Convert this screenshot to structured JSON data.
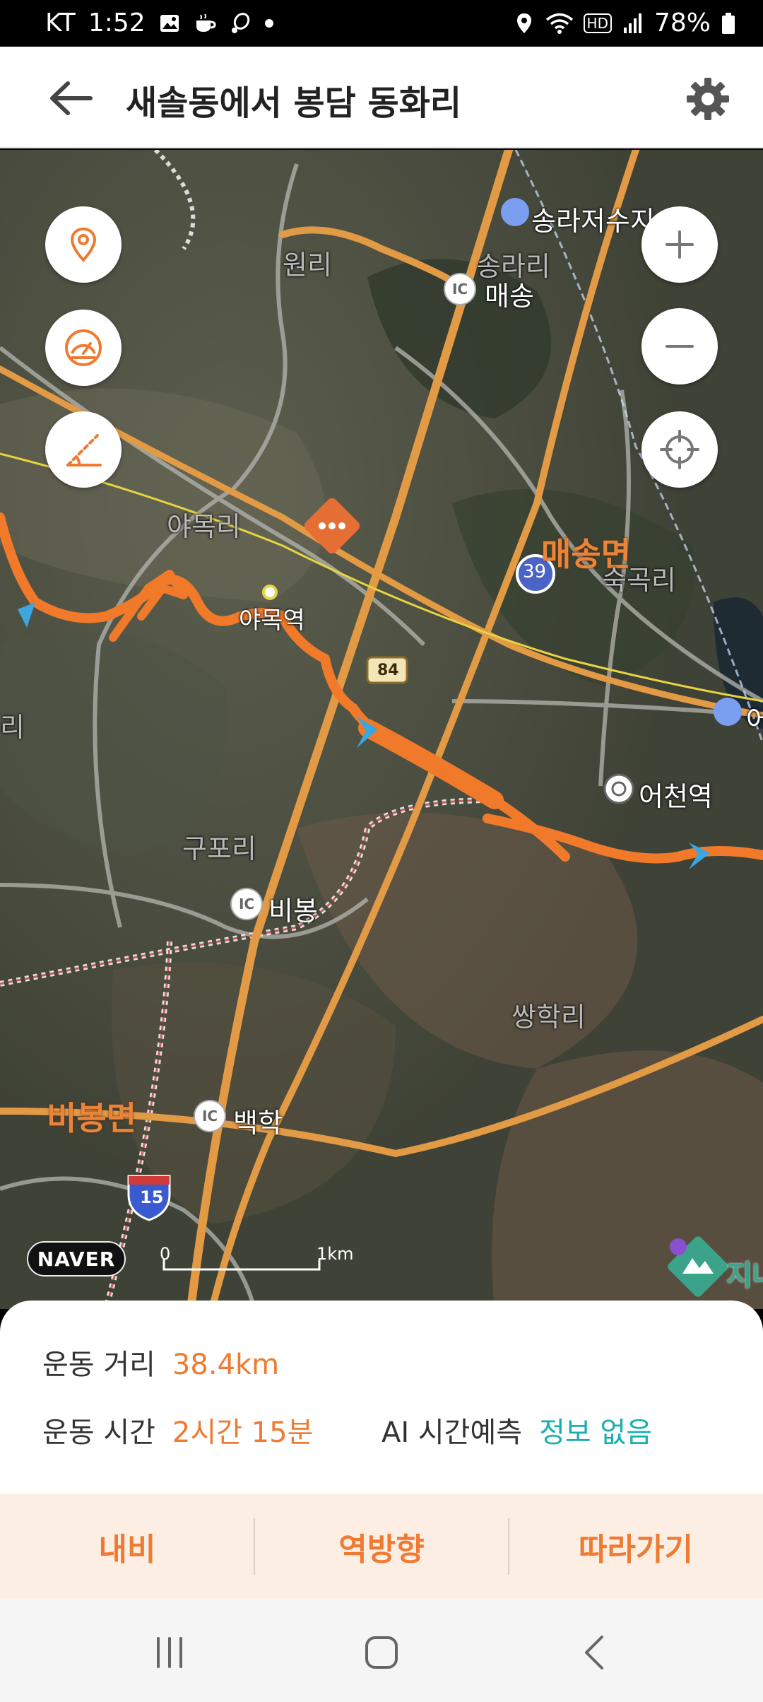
{
  "status_bar": {
    "carrier": "KT",
    "time": "1:52",
    "hd_label": "HD",
    "battery": "78%"
  },
  "header": {
    "title": "새솔동에서 봉담 동화리"
  },
  "map": {
    "places": {
      "songra_reservoir": "송라저수지",
      "wonri": "원리",
      "songrari": "송라리",
      "maesong": "매송",
      "yamokri": "야목리",
      "yamok_station": "야목역",
      "maesong_myeon": "매송면",
      "sukgokri": "숙곡리",
      "route_39": "39",
      "route_84": "84",
      "eocheon_station": "어천역",
      "eo_partial": "어",
      "ri_partial": "리",
      "gupori": "구포리",
      "bibong": "비봉",
      "ssanghakri": "쌍학리",
      "bibong_myeon": "비봉면",
      "baekhak": "백학",
      "route_15": "15",
      "ji_partial": "지나",
      "ic_label": "IC"
    },
    "naver_logo": "NAVER",
    "scale_start": "0",
    "scale_end": "1km",
    "route_color": "#f07a2a"
  },
  "stats": {
    "distance_label": "운동 거리",
    "distance_value": "38.4km",
    "time_label": "운동 시간",
    "time_value": "2시간 15분",
    "ai_label": "AI 시간예측",
    "ai_value": "정보 없음"
  },
  "actions": {
    "navi": "내비",
    "reverse": "역방향",
    "follow": "따라가기"
  },
  "colors": {
    "accent": "#ef7b32",
    "ai_teal": "#17b0b0"
  }
}
